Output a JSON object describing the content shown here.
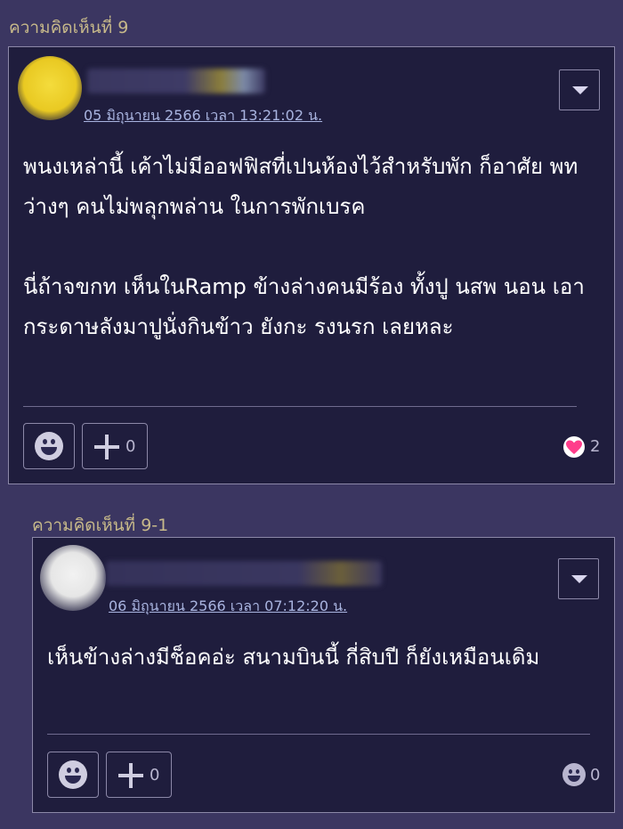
{
  "comments": [
    {
      "label": "ความคิดเห็นที่ 9",
      "date": "05 มิถุนายน 2566 เวลา 13:21:02 น.",
      "paragraphs": [
        "พนงเหล่านี้ เค้าไม่มีออฟฟิสที่เปนห้องไว้สำหรับพัก ก็อาศัย พท ว่างๆ คนไม่พลุกพล่าน ในการพักเบรค",
        "นี่ถ้าจขกท เห็นในRamp ข้างล่างคนมีร้อง ทั้งปู นสพ นอน เอากระดาษลังมาปูนั่งกินข้าว ยังกะ รงนรก เลยหละ"
      ],
      "plus_count": "0",
      "reaction_count": "2"
    },
    {
      "label": "ความคิดเห็นที่ 9-1",
      "date": "06 มิถุนายน 2566 เวลา 07:12:20 น.",
      "paragraphs": [
        "เห็นข้างล่างมีช็อคอ่ะ สนามบินนี้ กี่สิบปี ก็ยังเหมือนเดิม"
      ],
      "plus_count": "0",
      "reaction_count": "0"
    }
  ],
  "icons": {
    "menu": "chevron-down-icon",
    "emotion": "smiley-icon",
    "plus": "plus-icon",
    "heart": "heart-icon"
  },
  "colors": {
    "page_bg": "#3b3661",
    "card_bg": "#1f1d3d",
    "label": "#c7b98a",
    "date": "#a9b4e0",
    "heart": "#ff3d8b"
  }
}
